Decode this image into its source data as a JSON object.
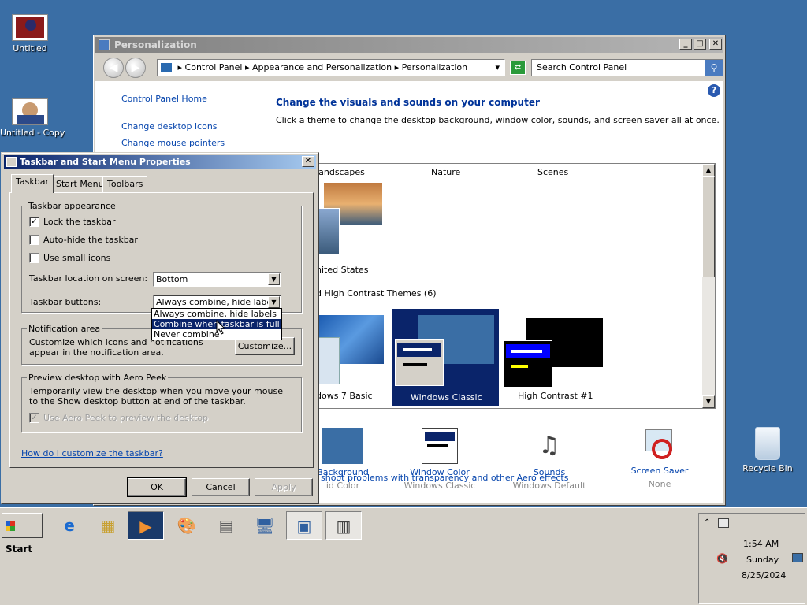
{
  "desktop": {
    "icons": [
      {
        "label": "Untitled"
      },
      {
        "label": "Untitled - Copy"
      },
      {
        "label": "Recycle Bin"
      }
    ]
  },
  "personalization": {
    "title": "Personalization",
    "breadcrumb": [
      "Control Panel",
      "Appearance and Personalization",
      "Personalization"
    ],
    "search_placeholder": "Search Control Panel",
    "left_links": [
      "Control Panel Home",
      "Change desktop icons",
      "Change mouse pointers"
    ],
    "heading": "Change the visuals and sounds on your computer",
    "subheading": "Click a theme to change the desktop background, window color, sounds, and screen saver all at once.",
    "theme_columns": [
      "Landscapes",
      "Nature",
      "Scenes"
    ],
    "united_states_label": "nited States",
    "section_label": "d High Contrast Themes (6)",
    "themes": [
      "dows 7 Basic",
      "Windows Classic",
      "High Contrast #1"
    ],
    "bottom_items": [
      {
        "label": "Background",
        "sub": "id Color"
      },
      {
        "label": "Window Color",
        "sub": "Windows Classic"
      },
      {
        "label": "Sounds",
        "sub": "Windows Default"
      },
      {
        "label": "Screen Saver",
        "sub": "None"
      }
    ],
    "troubleshoot": "shoot problems with transparency and other Aero effects"
  },
  "dialog": {
    "title": "Taskbar and Start Menu Properties",
    "tabs": [
      "Taskbar",
      "Start Menu",
      "Toolbars"
    ],
    "appearance_group": "Taskbar appearance",
    "lock_taskbar": "Lock the taskbar",
    "auto_hide": "Auto-hide the taskbar",
    "small_icons": "Use small icons",
    "location_label": "Taskbar location on screen:",
    "location_value": "Bottom",
    "buttons_label": "Taskbar buttons:",
    "buttons_value": "Always combine, hide labels",
    "dropdown_options": [
      "Always combine, hide labels",
      "Combine when taskbar is full",
      "Never combine"
    ],
    "notification_group": "Notification area",
    "notification_text": "Customize which icons and notifications appear in the notification area.",
    "customize_btn": "Customize...",
    "peek_group": "Preview desktop with Aero Peek",
    "peek_text": "Temporarily view the desktop when you move your mouse to the Show desktop button at end of the taskbar.",
    "peek_checkbox": "Use Aero Peek to preview the desktop",
    "help_link": "How do I customize the taskbar?",
    "ok": "OK",
    "cancel": "Cancel",
    "apply": "Apply"
  },
  "taskbar": {
    "start": "Start",
    "clock_time": "1:54 AM",
    "clock_day": "Sunday",
    "clock_date": "8/25/2024"
  }
}
